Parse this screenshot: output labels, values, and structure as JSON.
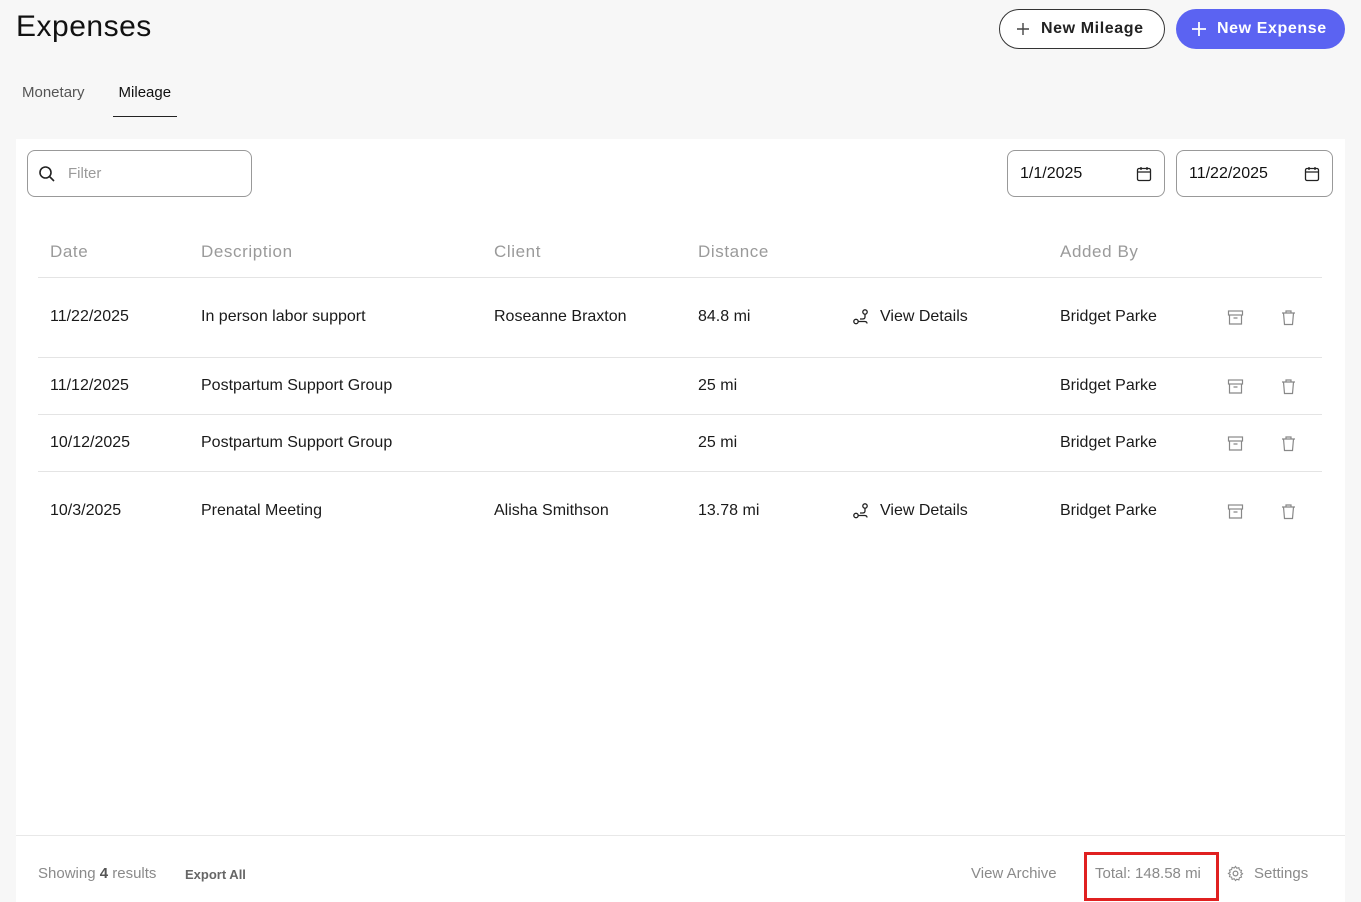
{
  "header": {
    "title": "Expenses",
    "new_mileage_label": "New Mileage",
    "new_expense_label": "New Expense"
  },
  "tabs": [
    {
      "label": "Monetary",
      "active": false
    },
    {
      "label": "Mileage",
      "active": true
    }
  ],
  "filters": {
    "search_placeholder": "Filter",
    "start_date": "1/1/2025",
    "end_date": "11/22/2025"
  },
  "table": {
    "columns": [
      "Date",
      "Description",
      "Client",
      "Distance",
      "Added By"
    ],
    "rows": [
      {
        "date": "11/22/2025",
        "description": "In person labor support",
        "client": "Roseanne Braxton",
        "distance": "84.8 mi",
        "details": "View Details",
        "added_by": "Bridget Parke"
      },
      {
        "date": "11/12/2025",
        "description": "Postpartum Support Group",
        "client": "",
        "distance": "25 mi",
        "details": "",
        "added_by": "Bridget Parke"
      },
      {
        "date": "10/12/2025",
        "description": "Postpartum Support Group",
        "client": "",
        "distance": "25 mi",
        "details": "",
        "added_by": "Bridget Parke"
      },
      {
        "date": "10/3/2025",
        "description": "Prenatal Meeting",
        "client": "Alisha Smithson",
        "distance": "13.78 mi",
        "details": "View Details",
        "added_by": "Bridget Parke"
      }
    ]
  },
  "footer": {
    "showing_prefix": "Showing",
    "result_count": "4",
    "showing_suffix": "results",
    "export_label": "Export All",
    "view_archive_label": "View Archive",
    "total_label": "Total: 148.58 mi",
    "settings_label": "Settings"
  },
  "colors": {
    "primary": "#5b63f2",
    "highlight": "#e02020"
  }
}
